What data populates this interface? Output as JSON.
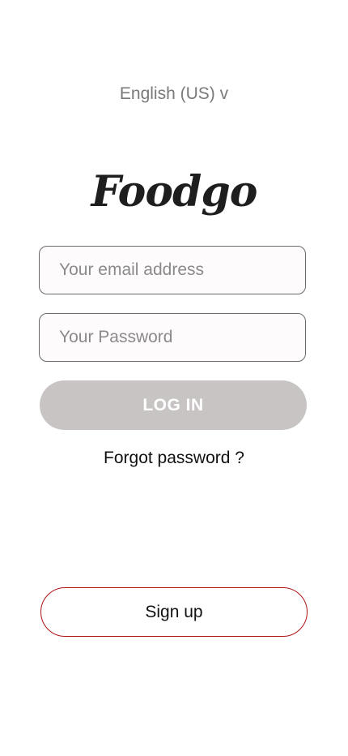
{
  "language_selector": "English (US) v",
  "brand": {
    "logo_text": "Foodgo"
  },
  "login_form": {
    "email_placeholder": "Your email address",
    "password_placeholder": "Your Password",
    "login_label": "LOG IN",
    "forgot_label": "Forgot password ?"
  },
  "signup": {
    "label": "Sign up"
  },
  "colors": {
    "login_button_bg": "#c9c4c4",
    "signup_border": "#b11313",
    "logo": "#1e1e1e"
  }
}
